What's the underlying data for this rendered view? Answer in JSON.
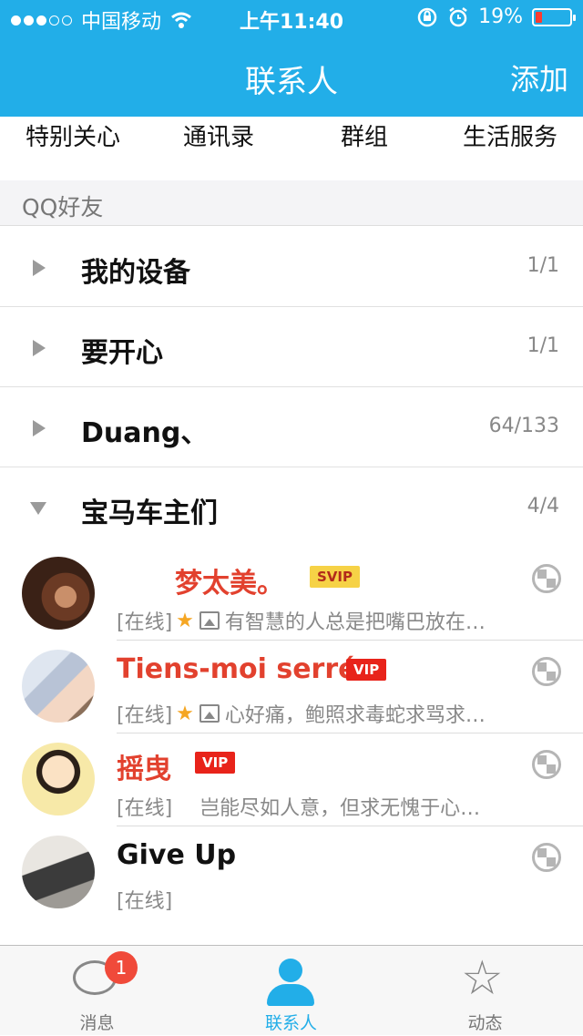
{
  "status_bar": {
    "carrier": "中国移动",
    "time": "上午11:40",
    "battery": "19%",
    "battery_level": 0.19,
    "signal_bars_filled": 3,
    "signal_bars_total": 5
  },
  "nav": {
    "title": "联系人",
    "add": "添加"
  },
  "tabs": [
    "特别关心",
    "通讯录",
    "群组",
    "生活服务"
  ],
  "section": {
    "title": "QQ好友"
  },
  "groups": [
    {
      "name": "我的设备",
      "count": "1/1",
      "expanded": false
    },
    {
      "name": "要开心",
      "count": "1/1",
      "expanded": false
    },
    {
      "name": "Duang、",
      "count": "64/133",
      "expanded": false
    },
    {
      "name": "宝马车主们",
      "count": "4/4",
      "expanded": true
    }
  ],
  "contacts": [
    {
      "name": "梦太美。",
      "badge": "SVIP",
      "status": "[在线]",
      "signature": "有智慧的人总是把嘴巴放在…",
      "name_color": "#e2412e"
    },
    {
      "name": "Tiens-moi serré",
      "badge": "VIP",
      "status": "[在线]",
      "signature": "心好痛，鲍照求毒蛇求骂求…",
      "name_color": "#e2412e"
    },
    {
      "name": "摇曳",
      "badge": "VIP",
      "status": "[在线]",
      "signature": "岂能尽如人意，但求无愧于心…",
      "name_color": "#e2412e"
    },
    {
      "name": "Give Up",
      "badge": "",
      "status": "[在线]",
      "signature": "",
      "name_color": "#111111"
    }
  ],
  "tabbar": {
    "messages": {
      "label": "消息",
      "badge": "1",
      "icon": "chat-bubble-icon"
    },
    "contacts": {
      "label": "联系人",
      "icon": "person-icon"
    },
    "feeds": {
      "label": "动态",
      "icon": "star-icon"
    }
  },
  "colors": {
    "brand": "#22aee8",
    "vip_red": "#e8231a",
    "svip_gold": "#f6d246"
  }
}
